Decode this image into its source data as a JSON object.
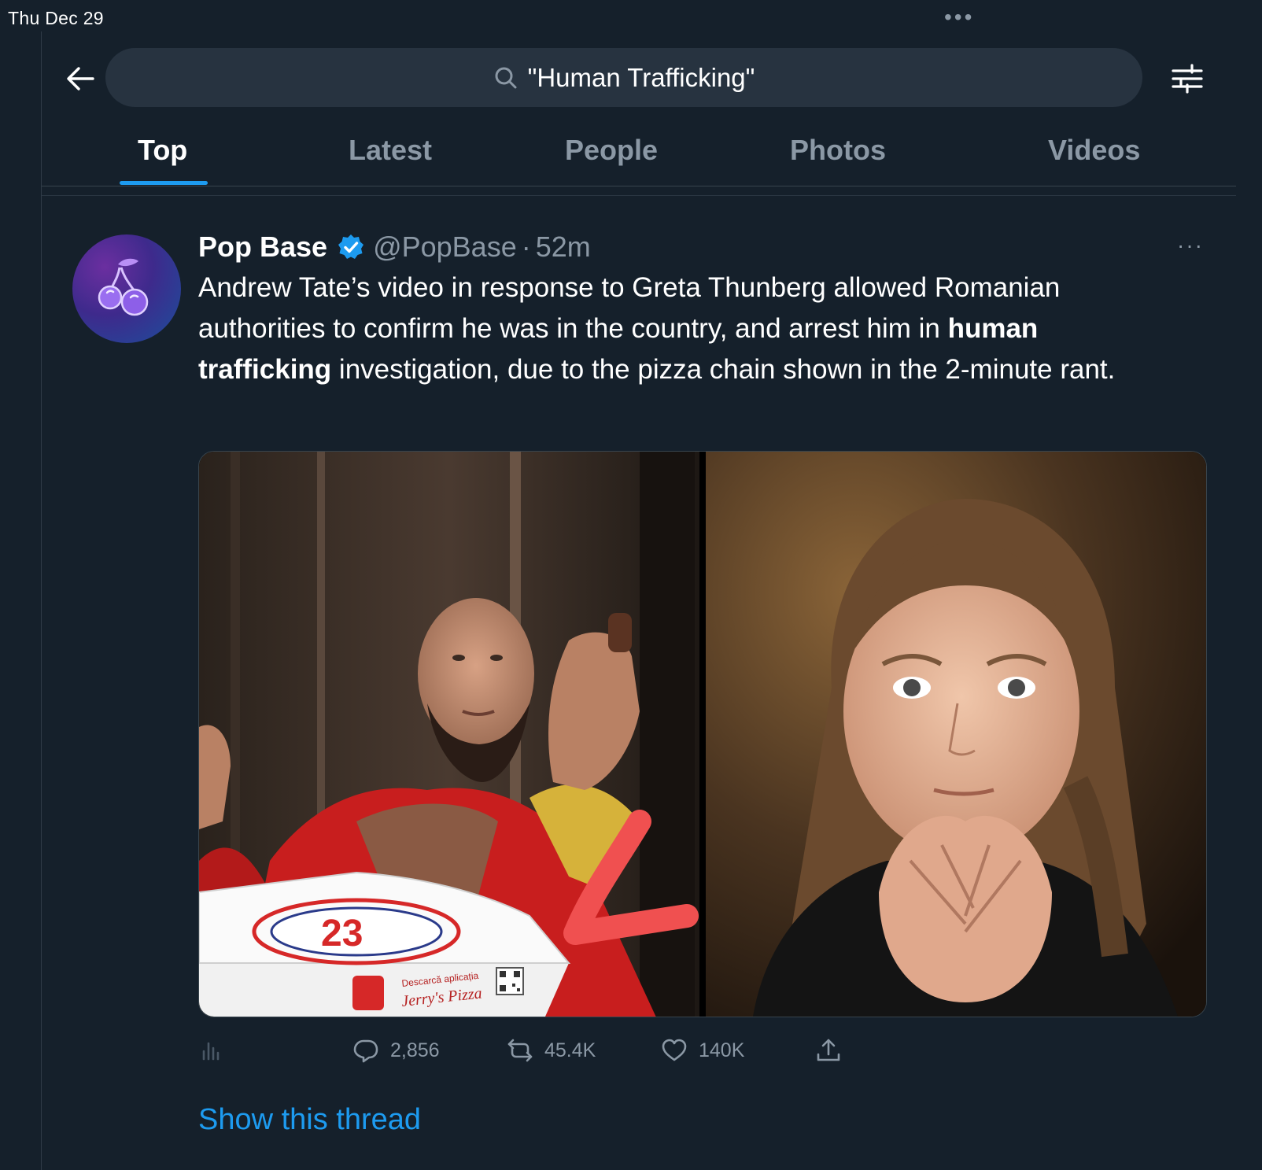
{
  "status_bar": {
    "date": "Thu Dec 29",
    "dots": "•••"
  },
  "search": {
    "query": "\"Human Trafficking\""
  },
  "tabs": [
    {
      "label": "Top",
      "active": true
    },
    {
      "label": "Latest",
      "active": false
    },
    {
      "label": "People",
      "active": false
    },
    {
      "label": "Photos",
      "active": false
    },
    {
      "label": "Videos",
      "active": false
    }
  ],
  "tweet": {
    "author_name": "Pop Base",
    "handle": "@PopBase",
    "separator": "·",
    "time": "52m",
    "more": "···",
    "text_part1": "Andrew Tate’s video in response to Greta Thunberg allowed Romanian authorities to confirm he was in the country, and arrest him in ",
    "text_bold": "human trafficking",
    "text_part2": " investigation, due to the pizza chain shown in the 2-minute rant.",
    "media_left_text": {
      "box_line1": "Descarcă aplicația",
      "box_brand": "Jerry's Pizza"
    },
    "actions": {
      "replies": "2,856",
      "retweets": "45.4K",
      "likes": "140K"
    },
    "show_thread": "Show this thread"
  },
  "colors": {
    "background": "#15202b",
    "accent": "#1d9bf0",
    "secondary_text": "#8b98a5",
    "search_bg": "#273340"
  }
}
